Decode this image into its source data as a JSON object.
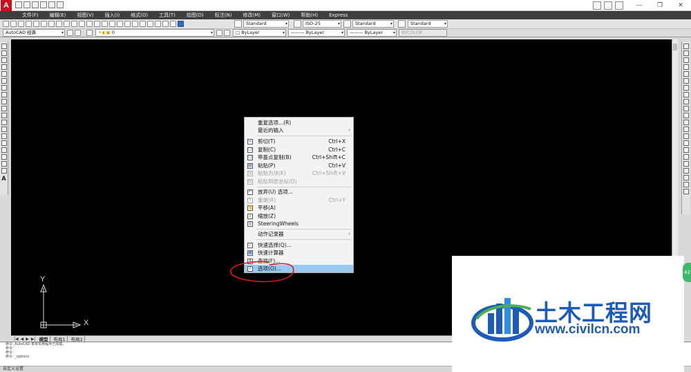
{
  "app": {
    "logo_letter": "A",
    "window_controls": [
      "—",
      "❐",
      "✕"
    ]
  },
  "menubar": {
    "items": [
      "文件(F)",
      "编辑(E)",
      "视图(V)",
      "插入(I)",
      "格式(O)",
      "工具(T)",
      "绘图(D)",
      "标注(N)",
      "修改(M)",
      "窗口(W)",
      "帮助(H)",
      "Express"
    ]
  },
  "toolbar": {
    "text_style": "Standard",
    "dim_style": "ISO-25",
    "table_style": "Standard",
    "mleader_style": "Standard",
    "workspace": "AutoCAD 经典",
    "layer": "0",
    "color": "ByLayer",
    "linetype": "ByLayer",
    "lineweight": "ByLayer",
    "plotstyle": "BYCOLOR"
  },
  "ucs": {
    "x_label": "X",
    "y_label": "Y"
  },
  "layout_tabs": {
    "arrows": [
      "|◀",
      "◀",
      "▶",
      "▶|"
    ],
    "tabs": [
      "模型",
      "布局1",
      "布局2"
    ],
    "active": "模型"
  },
  "command": {
    "lines": [
      "命令: AutoCAD 菜单实用程序已加载。",
      "命令:",
      "命令:",
      "命令: _options"
    ],
    "status": "自定义设置"
  },
  "context_menu": {
    "items": [
      {
        "label": "重复选项...(R)",
        "shortcut": "",
        "icon": "",
        "disabled": false
      },
      {
        "label": "最近的输入",
        "shortcut": "",
        "icon": "",
        "submenu": true,
        "disabled": false
      },
      {
        "label": "剪切(T)",
        "shortcut": "Ctrl+X",
        "icon": "cut-icon",
        "disabled": false
      },
      {
        "label": "复制(C)",
        "shortcut": "Ctrl+C",
        "icon": "copy-icon",
        "disabled": false
      },
      {
        "label": "带基点复制(B)",
        "shortcut": "Ctrl+Shift+C",
        "icon": "copy-base-icon",
        "disabled": false
      },
      {
        "label": "粘贴(P)",
        "shortcut": "Ctrl+V",
        "icon": "paste-icon",
        "disabled": false
      },
      {
        "label": "粘贴为块(K)",
        "shortcut": "Ctrl+Shift+V",
        "icon": "paste-block-icon",
        "disabled": true
      },
      {
        "label": "粘贴到原坐标(D)",
        "shortcut": "",
        "icon": "paste-orig-icon",
        "disabled": true
      },
      {
        "label": "放弃(U) 选项...",
        "shortcut": "",
        "icon": "undo-icon",
        "disabled": false
      },
      {
        "label": "重做(R)",
        "shortcut": "Ctrl+Y",
        "icon": "redo-icon",
        "disabled": true
      },
      {
        "label": "平移(A)",
        "shortcut": "",
        "icon": "pan-icon",
        "disabled": false
      },
      {
        "label": "缩放(Z)",
        "shortcut": "",
        "icon": "zoom-icon",
        "disabled": false
      },
      {
        "label": "SteeringWheels",
        "shortcut": "",
        "icon": "steeringwheels-icon",
        "disabled": false
      },
      {
        "label": "动作记录器",
        "shortcut": "",
        "icon": "",
        "submenu": true,
        "disabled": false
      },
      {
        "label": "快速选择(Q)...",
        "shortcut": "",
        "icon": "quick-select-icon",
        "disabled": false
      },
      {
        "label": "快速计算器",
        "shortcut": "",
        "icon": "calculator-icon",
        "disabled": false
      },
      {
        "label": "查找(F)...",
        "shortcut": "",
        "icon": "find-icon",
        "disabled": false
      },
      {
        "label": "选项(O)...",
        "shortcut": "",
        "icon": "options-icon",
        "disabled": false,
        "highlighted": true
      }
    ],
    "submenu_arrow": "›"
  },
  "annotation": {
    "color": "#e01818"
  },
  "watermark": {
    "title": "土木工程网",
    "url": "www.civilcn.com",
    "brand_color": "#1c5cb8"
  },
  "badge": {
    "text": "42"
  },
  "colors": {
    "canvas": "#000000",
    "menubar": "#3f3f3f",
    "highlight": "#99c9f0"
  }
}
